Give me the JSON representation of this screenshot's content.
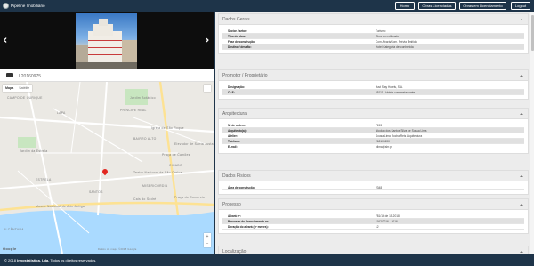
{
  "header": {
    "brand": "Pipeline Imobiliário",
    "nav": [
      {
        "label": "Home"
      },
      {
        "label": "Obras Licenciadas"
      },
      {
        "label": "Obras em Licenciamento"
      },
      {
        "label": "Logout"
      }
    ]
  },
  "gallery": {
    "reference": "L20160975"
  },
  "map": {
    "types": [
      "Mapa",
      "Satélite"
    ],
    "labels": [
      "LAPA",
      "SANTOS",
      "CAMPO DE OURIQUE",
      "PRÍNCIPE REAL",
      "CHIADO",
      "BAIRRO ALTO",
      "ALCÂNTARA",
      "MISERICÓRDIA",
      "ESTRELA",
      "Praça de Camões",
      "Jardim da Estrela",
      "Cais do Sodré",
      "Igreja de São Roque",
      "Elevador de Santa Justa",
      "Praça do Comércio",
      "Teatro Nacional de São Carlos",
      "Museu Nacional de Arte Antiga",
      "Jardim Botânico"
    ],
    "zoom_in": "+",
    "zoom_out": "−",
    "attribution": "Dados do mapa ©2018 Google",
    "google_logo": "Google"
  },
  "sections": [
    {
      "title": "Dados Gerais",
      "rows": [
        {
          "k": "Sector / setor:",
          "v": "Turismo"
        },
        {
          "k": "Tipo de obra:",
          "v": "Obra em edificado"
        },
        {
          "k": "Fase de construção:",
          "v": "Com Alvará/Com. Prévia Emitido"
        },
        {
          "k": "Destino / desafio:",
          "v": "Hotel Categoria desconhecida"
        }
      ]
    },
    {
      "title": "Promotor / Proprietário",
      "rows": [
        {
          "k": "Designação:",
          "v": "Just Stay Hotels, S.A."
        },
        {
          "k": "CAE:",
          "v": "55111 - Hotéis com restaurante"
        }
      ]
    },
    {
      "title": "Arquitectura",
      "rows": [
        {
          "k": "Nº de ordem:",
          "v": "7153"
        },
        {
          "k": "Arquitecto(a):",
          "v": "Nicolau dos Santos Silva de Sousa Lima"
        },
        {
          "k": "Atelier:",
          "v": "Sousa Lima Rocha Reis Arquitectura"
        },
        {
          "k": "Telefone:",
          "v": "218100690"
        },
        {
          "k": "E-mail:",
          "v": "nlima@slrr.pt"
        }
      ]
    },
    {
      "title": "Dados Físicos",
      "rows": [
        {
          "k": "Área de construção:",
          "v": "2348"
        }
      ]
    },
    {
      "title": "Processo",
      "rows": [
        {
          "k": "Alvará nº:",
          "v": "781/16 de 15-2018"
        },
        {
          "k": "Processo de licenciamento nº:",
          "v": "1162/2016 - 2016"
        },
        {
          "k": "Duração do alvará (nº meses):",
          "v": "12"
        }
      ]
    },
    {
      "title": "Localização",
      "rows": []
    }
  ],
  "footer": {
    "copyright_prefix": "© 2018 ",
    "company": "Innostatistica, Lda.",
    "copyright_suffix": " Todos os direitos reservados."
  },
  "colors": {
    "navy": "#1e3449",
    "panel_header": "#ececec",
    "pin": "#e2261f"
  }
}
